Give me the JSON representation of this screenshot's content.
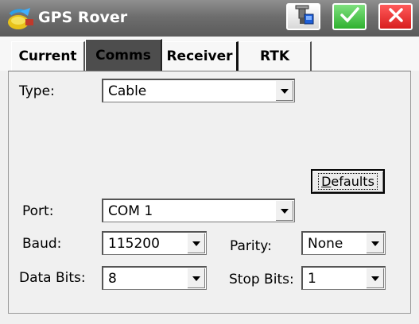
{
  "window": {
    "title": "GPS Rover",
    "buttons": {
      "tool_icon": "receiver-config-icon",
      "ok_icon": "checkmark-icon",
      "close_icon": "x-icon"
    }
  },
  "tabs": [
    {
      "label": "Current"
    },
    {
      "label": "Comms",
      "selected": true
    },
    {
      "label": "Receiver"
    },
    {
      "label": "RTK"
    }
  ],
  "comms": {
    "type": {
      "label": "Type:",
      "value": "Cable"
    },
    "defaults_button": {
      "mnemonic": "D",
      "rest": "efaults"
    },
    "port": {
      "label": "Port:",
      "value": "COM 1"
    },
    "baud": {
      "label": "Baud:",
      "value": "115200"
    },
    "parity": {
      "label": "Parity:",
      "value": "None"
    },
    "data_bits": {
      "label": "Data Bits:",
      "value": "8"
    },
    "stop_bits": {
      "label": "Stop Bits:",
      "value": "1"
    }
  },
  "colors": {
    "titlebar": "#6e6e6e",
    "ok_green": "#2fb12f",
    "close_red": "#d81e1e",
    "selected_tab": "#4d4d4d"
  }
}
